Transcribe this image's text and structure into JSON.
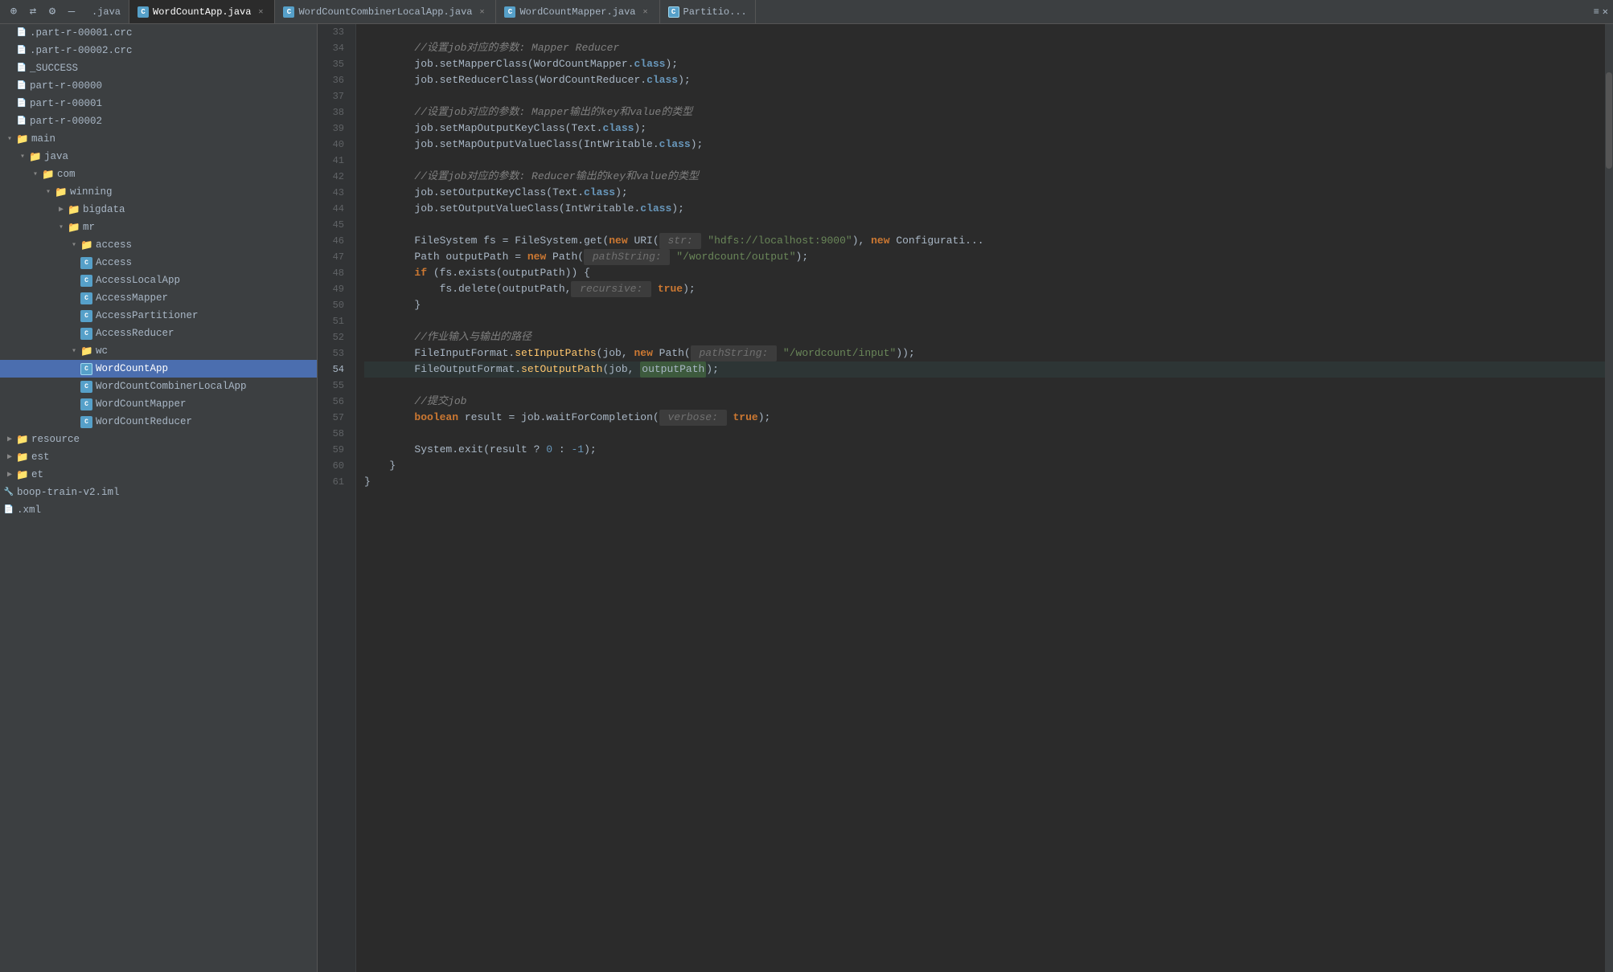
{
  "tabs": [
    {
      "id": "java",
      "label": ".java",
      "icon": null,
      "active": false,
      "closable": false
    },
    {
      "id": "wordcountapp",
      "label": "WordCountApp.java",
      "icon": "cyan",
      "active": true,
      "closable": true
    },
    {
      "id": "wordcountcombinerlocalapp",
      "label": "WordCountCombinerLocalApp.java",
      "icon": "cyan",
      "active": false,
      "closable": true
    },
    {
      "id": "wordcountmapper",
      "label": "WordCountMapper.java",
      "icon": "cyan",
      "active": false,
      "closable": true
    },
    {
      "id": "partition",
      "label": "Partitio...",
      "icon": "cyan-border",
      "active": false,
      "closable": false
    }
  ],
  "sidebar": {
    "items": [
      {
        "id": "part-r-00001-crc",
        "label": ".part-r-00001.crc",
        "depth": 0,
        "type": "file",
        "arrow": false
      },
      {
        "id": "part-r-00002-crc",
        "label": ".part-r-00002.crc",
        "depth": 0,
        "type": "file",
        "arrow": false
      },
      {
        "id": "success",
        "label": "_SUCCESS",
        "depth": 0,
        "type": "file",
        "arrow": false
      },
      {
        "id": "part-r-00000",
        "label": "part-r-00000",
        "depth": 0,
        "type": "file",
        "arrow": false
      },
      {
        "id": "part-r-00001",
        "label": "part-r-00001",
        "depth": 0,
        "type": "file",
        "arrow": false
      },
      {
        "id": "part-r-00002",
        "label": "part-r-00002",
        "depth": 0,
        "type": "file",
        "arrow": false
      },
      {
        "id": "main",
        "label": "main",
        "depth": 0,
        "type": "folder",
        "arrow": "open"
      },
      {
        "id": "java",
        "label": "java",
        "depth": 1,
        "type": "folder",
        "arrow": "open"
      },
      {
        "id": "com",
        "label": "com",
        "depth": 2,
        "type": "folder",
        "arrow": "open"
      },
      {
        "id": "winning",
        "label": "winning",
        "depth": 3,
        "type": "folder",
        "arrow": "open"
      },
      {
        "id": "bigdata",
        "label": "bigdata",
        "depth": 4,
        "type": "folder",
        "arrow": "closed"
      },
      {
        "id": "mr",
        "label": "mr",
        "depth": 4,
        "type": "folder",
        "arrow": "open"
      },
      {
        "id": "access",
        "label": "access",
        "depth": 5,
        "type": "folder",
        "arrow": "open"
      },
      {
        "id": "Access",
        "label": "Access",
        "depth": 6,
        "type": "class",
        "arrow": false,
        "iconColor": "cyan"
      },
      {
        "id": "AccessLocalApp",
        "label": "AccessLocalApp",
        "depth": 6,
        "type": "class",
        "arrow": false,
        "iconColor": "cyan"
      },
      {
        "id": "AccessMapper",
        "label": "AccessMapper",
        "depth": 6,
        "type": "class",
        "arrow": false,
        "iconColor": "cyan"
      },
      {
        "id": "AccessPartitioner",
        "label": "AccessPartitioner",
        "depth": 6,
        "type": "class",
        "arrow": false,
        "iconColor": "cyan"
      },
      {
        "id": "AccessReducer",
        "label": "AccessReducer",
        "depth": 6,
        "type": "class",
        "arrow": false,
        "iconColor": "cyan"
      },
      {
        "id": "wc",
        "label": "wc",
        "depth": 5,
        "type": "folder",
        "arrow": "open"
      },
      {
        "id": "WordCountApp",
        "label": "WordCountApp",
        "depth": 6,
        "type": "class",
        "arrow": false,
        "iconColor": "cyan-active"
      },
      {
        "id": "WordCountCombinerLocalApp",
        "label": "WordCountCombinerLocalApp",
        "depth": 6,
        "type": "class",
        "arrow": false,
        "iconColor": "cyan"
      },
      {
        "id": "WordCountMapper",
        "label": "WordCountMapper",
        "depth": 6,
        "type": "class",
        "arrow": false,
        "iconColor": "cyan"
      },
      {
        "id": "WordCountReducer",
        "label": "WordCountReducer",
        "depth": 6,
        "type": "class",
        "arrow": false,
        "iconColor": "cyan"
      },
      {
        "id": "resource",
        "label": "resource",
        "depth": 0,
        "type": "folder",
        "arrow": "closed"
      },
      {
        "id": "est",
        "label": "est",
        "depth": 0,
        "type": "folder",
        "arrow": "closed"
      },
      {
        "id": "et",
        "label": "et",
        "depth": 0,
        "type": "folder",
        "arrow": "closed"
      },
      {
        "id": "boop-train-v2-iml",
        "label": "boop-train-v2.iml",
        "depth": 0,
        "type": "file",
        "arrow": false
      },
      {
        "id": "xml",
        "label": ".xml",
        "depth": 0,
        "type": "file",
        "arrow": false
      }
    ]
  },
  "code": {
    "lines": [
      {
        "num": 33,
        "content": "",
        "tokens": []
      },
      {
        "num": 34,
        "content": "        <cm>//设置job对应的参数: </cm><cm-en>Mapper Reducer</cm-en>",
        "tokens": [
          {
            "t": "cm",
            "v": "        //设置job对应的参数: Mapper Reducer"
          }
        ]
      },
      {
        "num": 35,
        "content": "        job.setMapperClass(WordCountMapper.<cls-ref>class</cls-ref>);",
        "tokens": [
          {
            "t": "plain",
            "v": "        job.setMapperClass(WordCountMapper."
          },
          {
            "t": "cls-ref",
            "v": "class"
          },
          {
            "t": "plain",
            "v": ");"
          }
        ]
      },
      {
        "num": 36,
        "content": "        job.setReducerClass(WordCountReducer.<cls-ref>class</cls-ref>);",
        "tokens": [
          {
            "t": "plain",
            "v": "        job.setReducerClass(WordCountReducer."
          },
          {
            "t": "cls-ref",
            "v": "class"
          },
          {
            "t": "plain",
            "v": ");"
          }
        ]
      },
      {
        "num": 37,
        "content": "",
        "tokens": []
      },
      {
        "num": 38,
        "content": "        <cm>//设置job对应的参数: </cm><em>Mapper输出的key和value的类型</em>",
        "tokens": [
          {
            "t": "cm-italic",
            "v": "        //设置job对应的参数: Mapper输出的key和value的类型"
          }
        ]
      },
      {
        "num": 39,
        "content": "        job.setMapOutputKeyClass(Text.<cls-ref>class</cls-ref>);",
        "tokens": [
          {
            "t": "plain",
            "v": "        job.setMapOutputKeyClass(Text."
          },
          {
            "t": "cls-ref",
            "v": "class"
          },
          {
            "t": "plain",
            "v": ");"
          }
        ]
      },
      {
        "num": 40,
        "content": "        job.setMapOutputValueClass(IntWritable.<cls-ref>class</cls-ref>);",
        "tokens": [
          {
            "t": "plain",
            "v": "        job.setMapOutputValueClass(IntWritable."
          },
          {
            "t": "cls-ref",
            "v": "class"
          },
          {
            "t": "plain",
            "v": ");"
          }
        ]
      },
      {
        "num": 41,
        "content": "",
        "tokens": []
      },
      {
        "num": 42,
        "content": "        <cm>//设置job对应的参数: </cm><em>Reducer输出的key和value的类型</em>",
        "tokens": [
          {
            "t": "cm-italic",
            "v": "        //设置job对应的参数: Reducer输出的key和value的类型"
          }
        ]
      },
      {
        "num": 43,
        "content": "        job.setOutputKeyClass(Text.<cls-ref>class</cls-ref>);",
        "tokens": [
          {
            "t": "plain",
            "v": "        job.setOutputKeyClass(Text."
          },
          {
            "t": "cls-ref",
            "v": "class"
          },
          {
            "t": "plain",
            "v": ");"
          }
        ]
      },
      {
        "num": 44,
        "content": "        job.setOutputValueClass(IntWritable.<cls-ref>class</cls-ref>);",
        "tokens": [
          {
            "t": "plain",
            "v": "        job.setOutputValueClass(IntWritable."
          },
          {
            "t": "cls-ref",
            "v": "class"
          },
          {
            "t": "plain",
            "v": ");"
          }
        ]
      },
      {
        "num": 45,
        "content": "",
        "tokens": []
      },
      {
        "num": 46,
        "content": "        FileSystem fs = FileSystem.get(<kw>new</kw> URI( <hint>str:</hint> <str>\"hdfs://localhost:9000\"</str>), <kw>new</kw> Configurati...",
        "raw": true
      },
      {
        "num": 47,
        "content": "        Path outputPath = <kw>new</kw> Path( <hint>pathString:</hint> <str>\"/wordcount/output\"</str>);",
        "raw": true
      },
      {
        "num": 48,
        "content": "        <kw>if</kw> (fs.exists(outputPath)) {",
        "raw": true
      },
      {
        "num": 49,
        "content": "            fs.delete(outputPath, <hint>recursive:</hint> <kw-bold>true</kw-bold>);",
        "raw": true
      },
      {
        "num": 50,
        "content": "        }",
        "tokens": [
          {
            "t": "plain",
            "v": "        }"
          }
        ]
      },
      {
        "num": 51,
        "content": "",
        "tokens": []
      },
      {
        "num": 52,
        "content": "        <cm>//作业输入与输出的路径</cm>",
        "tokens": [
          {
            "t": "cm",
            "v": "        //作业输入与输出的路径"
          }
        ]
      },
      {
        "num": 53,
        "content": "        FileInputFormat.setInputPaths(job, <kw>new</kw> Path( <hint>pathString:</hint> <str>\"/wordcount/input\"</str>));",
        "raw": true
      },
      {
        "num": 54,
        "content": "        FileOutputFormat.setOutputPath(job, outputPath);",
        "active": true
      },
      {
        "num": 55,
        "content": "",
        "tokens": []
      },
      {
        "num": 56,
        "content": "        <cm>//提交job</cm>",
        "tokens": [
          {
            "t": "cm",
            "v": "        //提交job"
          }
        ]
      },
      {
        "num": 57,
        "content": "        <kw>boolean</kw> result = job.waitForCompletion( <hint>verbose:</hint> <kw-bold>true</kw-bold>);",
        "raw": true
      },
      {
        "num": 58,
        "content": "",
        "tokens": []
      },
      {
        "num": 59,
        "content": "        System.exit(result ? <nm>0</nm> : <nm>-1</nm>);",
        "raw": true
      },
      {
        "num": 60,
        "content": "    }",
        "tokens": [
          {
            "t": "plain",
            "v": "    }"
          }
        ]
      },
      {
        "num": 61,
        "content": "}",
        "tokens": [
          {
            "t": "plain",
            "v": "}"
          }
        ]
      }
    ]
  }
}
